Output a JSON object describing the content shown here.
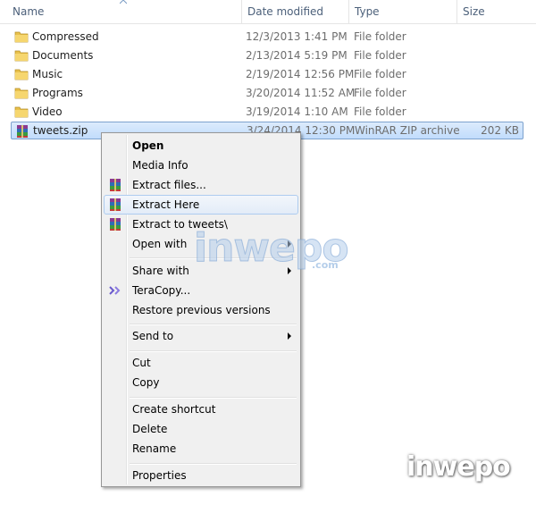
{
  "columns": {
    "name": "Name",
    "date_modified": "Date modified",
    "type": "Type",
    "size": "Size"
  },
  "files": [
    {
      "name": "Compressed",
      "date": "12/3/2013 1:41 PM",
      "type": "File folder",
      "size": "",
      "icon": "folder-icon"
    },
    {
      "name": "Documents",
      "date": "2/13/2014 5:19 PM",
      "type": "File folder",
      "size": "",
      "icon": "folder-icon"
    },
    {
      "name": "Music",
      "date": "2/19/2014 12:56 PM",
      "type": "File folder",
      "size": "",
      "icon": "folder-icon"
    },
    {
      "name": "Programs",
      "date": "3/20/2014 11:52 AM",
      "type": "File folder",
      "size": "",
      "icon": "folder-icon"
    },
    {
      "name": "Video",
      "date": "3/19/2014 1:10 AM",
      "type": "File folder",
      "size": "",
      "icon": "folder-icon"
    },
    {
      "name": "tweets.zip",
      "date": "3/24/2014 12:30 PM",
      "type": "WinRAR ZIP archive",
      "size": "202 KB",
      "icon": "winrar-archive-icon",
      "selected": true
    }
  ],
  "context_menu": {
    "items": [
      {
        "label": "Open",
        "bold": true
      },
      {
        "label": "Media Info"
      },
      {
        "label": "Extract files...",
        "icon": "winrar-icon"
      },
      {
        "label": "Extract Here",
        "icon": "winrar-icon",
        "hover": true
      },
      {
        "label": "Extract to tweets\\",
        "icon": "winrar-icon"
      },
      {
        "label": "Open with",
        "submenu": true
      },
      {
        "label": "Share with",
        "submenu": true
      },
      {
        "label": "TeraCopy...",
        "icon": "teracopy-icon"
      },
      {
        "label": "Restore previous versions"
      },
      {
        "label": "Send to",
        "submenu": true
      },
      {
        "label": "Cut"
      },
      {
        "label": "Copy"
      },
      {
        "label": "Create shortcut"
      },
      {
        "label": "Delete"
      },
      {
        "label": "Rename"
      },
      {
        "label": "Properties"
      }
    ]
  },
  "watermark": {
    "logo_text": "inwepo",
    "logo_suffix": ".com"
  },
  "colors": {
    "header_text": "#4c607a",
    "selection_border": "#7da2ce",
    "menu_background": "#f0f0f0",
    "hover_border": "#aeccef"
  }
}
